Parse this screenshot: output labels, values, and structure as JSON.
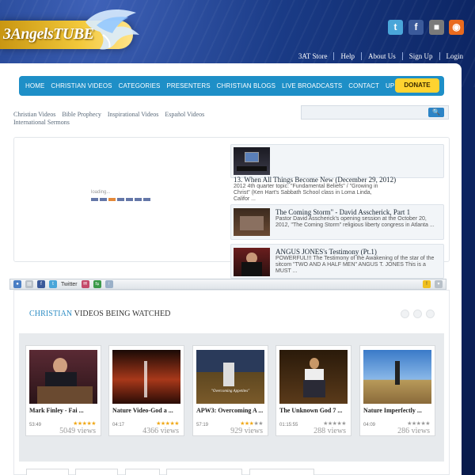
{
  "header": {
    "logo_text": "3AngelsTUBE"
  },
  "social": [
    {
      "name": "twitter-icon",
      "glyph": "t",
      "color": "#4aa6d9"
    },
    {
      "name": "facebook-icon",
      "glyph": "f",
      "color": "#3b5a9a"
    },
    {
      "name": "delicious-icon",
      "glyph": "■",
      "color": "#7a7a7a"
    },
    {
      "name": "rss-icon",
      "glyph": "◉",
      "color": "#e96a1e"
    }
  ],
  "top_links": [
    "3AT Store",
    "Help",
    "About Us",
    "Sign Up",
    "Login"
  ],
  "menu": [
    "HOME",
    "CHRISTIAN VIDEOS",
    "CATEGORIES",
    "PRESENTERS",
    "CHRISTIAN BLOGS",
    "LIVE BROADCASTS",
    "CONTACT",
    "UPLOAD"
  ],
  "donate_label": "DONATE",
  "categories": [
    "Christian Videos",
    "Bible Prophecy",
    "Inspirational Videos",
    "Español Videos",
    "International Sermons"
  ],
  "search": {
    "placeholder": "",
    "button": "🔍"
  },
  "player": {
    "loading_text": "loading..."
  },
  "featured": [
    {
      "title": "13. When All Things Become New (December 29, 2012)",
      "desc": "2012 4th quarter topic: \"Fundamental Beliefs\" / \"Growing in Christ\" (Ken Hart's Sabbath School class in Loma Linda, Califor ..."
    },
    {
      "title": "The Coming Storm\" - David Asscherick, Part 1",
      "desc": "Pastor David Asscherick's opening session at the October 20, 2012, \"The Coming Storm\" religious liberty congress in Atlanta ..."
    },
    {
      "title": "ANGUS JONES's Testimony (Pt.1)",
      "desc": "POWERFUL!!! The Testimony of the Awakening of the star of the sitcom \"TWO AND A HALF MEN\" ANGUS T. JONES This is a MUST ..."
    }
  ],
  "share_toolbar": {
    "twitter_label": "Twitter"
  },
  "watching": {
    "highlight": "CHRISTIAN",
    "rest": " VIDEOS BEING WATCHED"
  },
  "videos": [
    {
      "title": "Mark Finley - Fai ...",
      "duration": "53:49",
      "views": "5049 views",
      "stars": 5
    },
    {
      "title": "Nature Video-God a ...",
      "duration": "04:17",
      "views": "4366 views",
      "stars": 5
    },
    {
      "title": "APW3: Overcoming A ...",
      "duration": "57:19",
      "views": "929 views",
      "stars": 3
    },
    {
      "title": "The Unknown God 7 ...",
      "duration": "01:15:55",
      "views": "288 views",
      "stars": 0
    },
    {
      "title": "Nature Imperfectly ...",
      "duration": "04:09",
      "views": "286 views",
      "stars": 0
    }
  ],
  "thumb_captions": {
    "apw3": "\"Overcoming Appetites\""
  }
}
